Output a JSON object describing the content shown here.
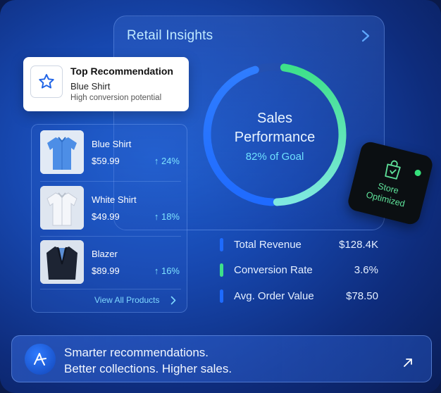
{
  "insights": {
    "title": "Retail Insights"
  },
  "recommendation": {
    "title": "Top Recommendation",
    "product": "Blue Shirt",
    "subtitle": "High conversion potential"
  },
  "products": [
    {
      "name": "Blue Shirt",
      "price": "$59.99",
      "trend": "↑ 24%",
      "image": "blue-shirt-image"
    },
    {
      "name": "White Shirt",
      "price": "$49.99",
      "trend": "↑ 18%",
      "image": "white-shirt-image"
    },
    {
      "name": "Blazer",
      "price": "$89.99",
      "trend": "↑ 16%",
      "image": "blazer-image"
    }
  ],
  "view_all": "View All Products",
  "performance": {
    "title_line1": "Sales",
    "title_line2": "Performance",
    "subtitle": "82% of Goal",
    "progress": 0.82
  },
  "badge": {
    "line1": "Store",
    "line2": "Optimized",
    "icon": "shopping-bag-icon"
  },
  "metrics": [
    {
      "label": "Total Revenue",
      "value": "$128.4K",
      "color": "#1e6bff"
    },
    {
      "label": "Conversion Rate",
      "value": "3.6%",
      "color": "#3ee08a"
    },
    {
      "label": "Avg. Order Value",
      "value": "$78.50",
      "color": "#1e6bff"
    }
  ],
  "banner": {
    "line1": "Smarter recommendations.",
    "line2": "Better collections. Higher sales."
  },
  "colors": {
    "accent_blue": "#1e6bff",
    "accent_green": "#3ee08a",
    "accent_cyan": "#6fe1ff"
  }
}
